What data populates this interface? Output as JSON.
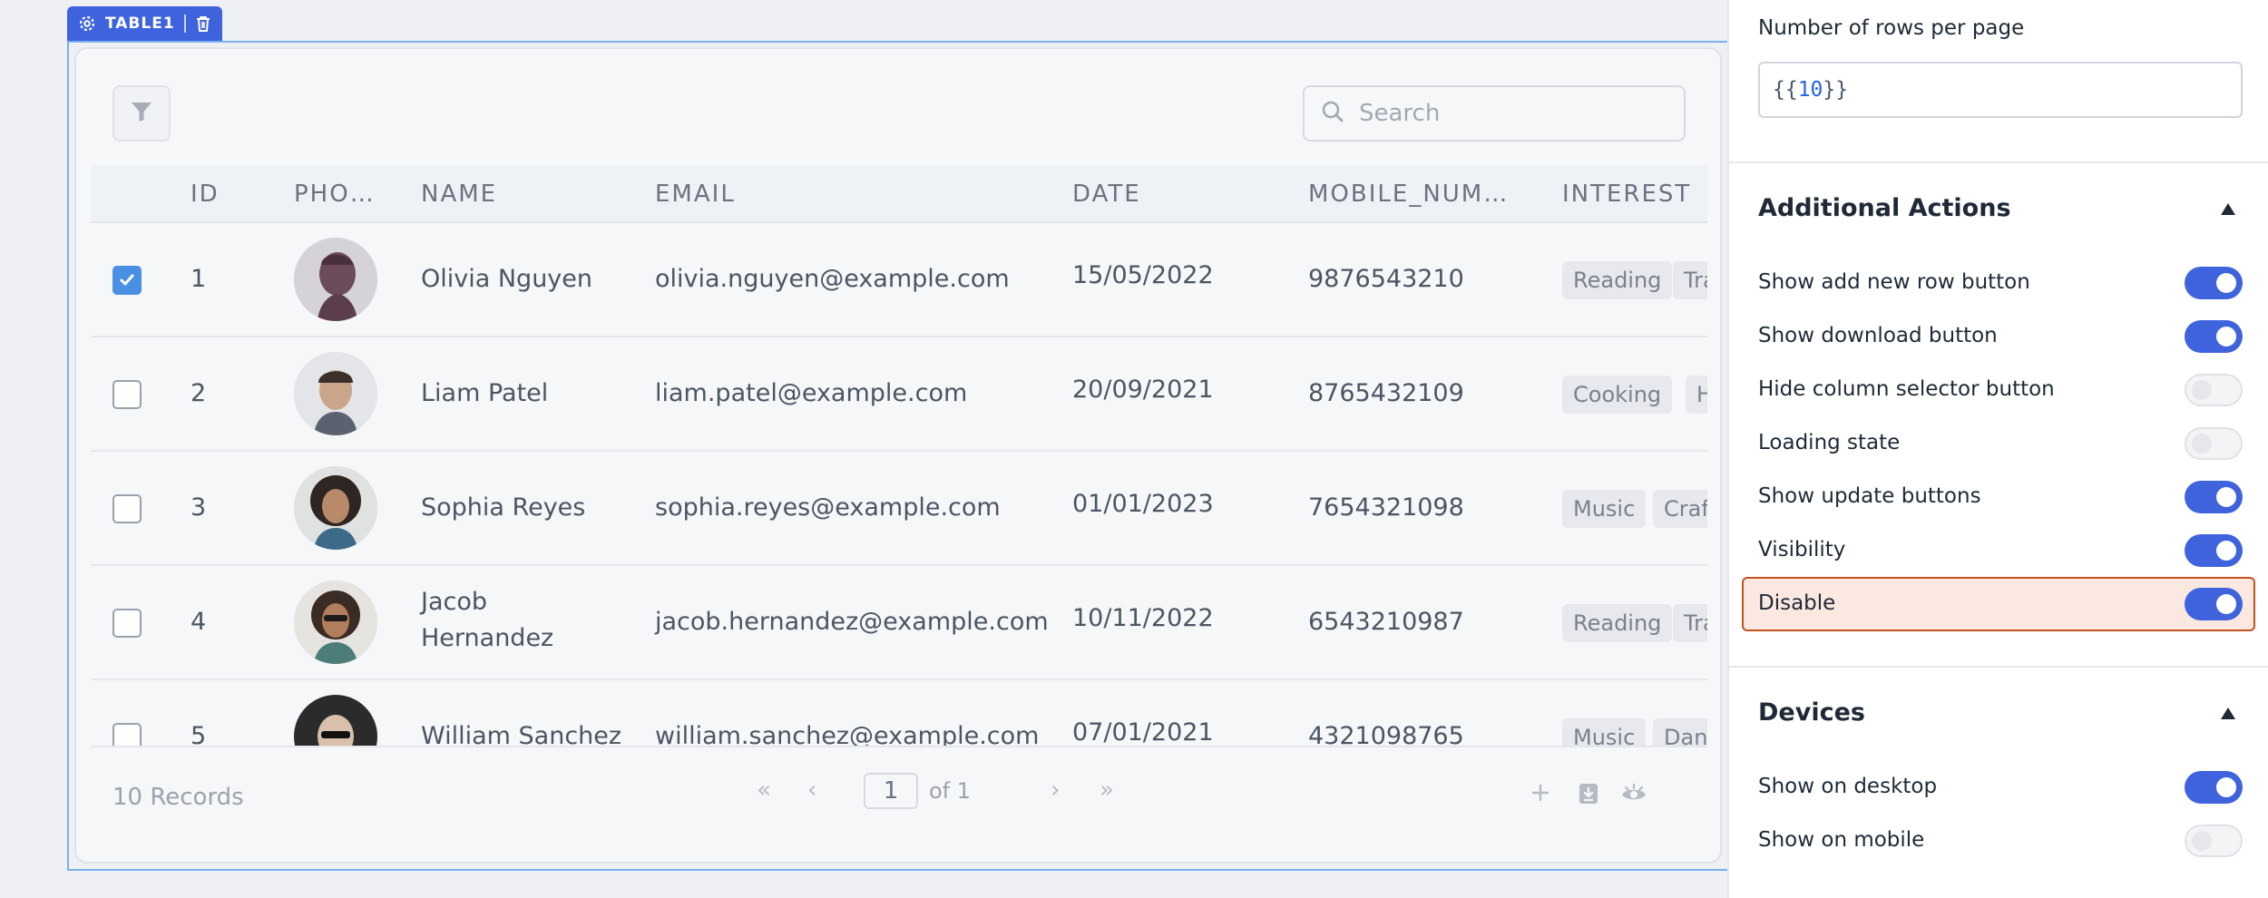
{
  "widget": {
    "name": "TABLE1"
  },
  "table": {
    "search_placeholder": "Search",
    "columns": [
      "ID",
      "PHO…",
      "NAME",
      "EMAIL",
      "DATE",
      "MOBILE_NUM…",
      "INTEREST"
    ],
    "rows": [
      {
        "id": "1",
        "name": "Olivia Nguyen",
        "email": "olivia.nguyen@example.com",
        "date": "15/05/2022",
        "mobile": "9876543210",
        "interests": [
          "Reading",
          "Tra"
        ],
        "checked": true
      },
      {
        "id": "2",
        "name": "Liam Patel",
        "email": "liam.patel@example.com",
        "date": "20/09/2021",
        "mobile": "8765432109",
        "interests": [
          "Cooking",
          "Hik"
        ],
        "checked": false
      },
      {
        "id": "3",
        "name": "Sophia Reyes",
        "email": "sophia.reyes@example.com",
        "date": "01/01/2023",
        "mobile": "7654321098",
        "interests": [
          "Music",
          "Craft"
        ],
        "checked": false
      },
      {
        "id": "4",
        "name_line1": "Jacob",
        "name_line2": "Hernandez",
        "email": "jacob.hernandez@example.com",
        "date": "10/11/2022",
        "mobile": "6543210987",
        "interests": [
          "Reading",
          "Tra"
        ],
        "checked": false
      },
      {
        "id": "5",
        "name": "William Sanchez",
        "email": "william.sanchez@example.com",
        "date": "07/01/2021",
        "mobile": "4321098765",
        "interests": [
          "Music",
          "Danc"
        ],
        "checked": false
      }
    ],
    "footer": {
      "records": "10 Records",
      "first": "«",
      "prev": "‹",
      "next": "›",
      "last": "»",
      "page": "1",
      "of_label": "of 1"
    }
  },
  "panel": {
    "rows_per_page_label": "Number of rows per page",
    "rows_per_page_open": "{{",
    "rows_per_page_value": "10",
    "rows_per_page_close": "}}",
    "additional_actions": {
      "title": "Additional Actions",
      "items": [
        {
          "label": "Show add new row button",
          "on": true
        },
        {
          "label": "Show download button",
          "on": true
        },
        {
          "label": "Hide column selector button",
          "on": false
        },
        {
          "label": "Loading state",
          "on": false
        },
        {
          "label": "Show update buttons",
          "on": true
        },
        {
          "label": "Visibility",
          "on": true
        },
        {
          "label": "Disable",
          "on": true
        }
      ]
    },
    "devices": {
      "title": "Devices",
      "items": [
        {
          "label": "Show on desktop",
          "on": true
        },
        {
          "label": "Show on mobile",
          "on": false
        }
      ]
    }
  },
  "colors": {
    "accent": "#3e63dd",
    "highlight_border": "#c2531d",
    "highlight_bg": "#fbe9e1"
  }
}
